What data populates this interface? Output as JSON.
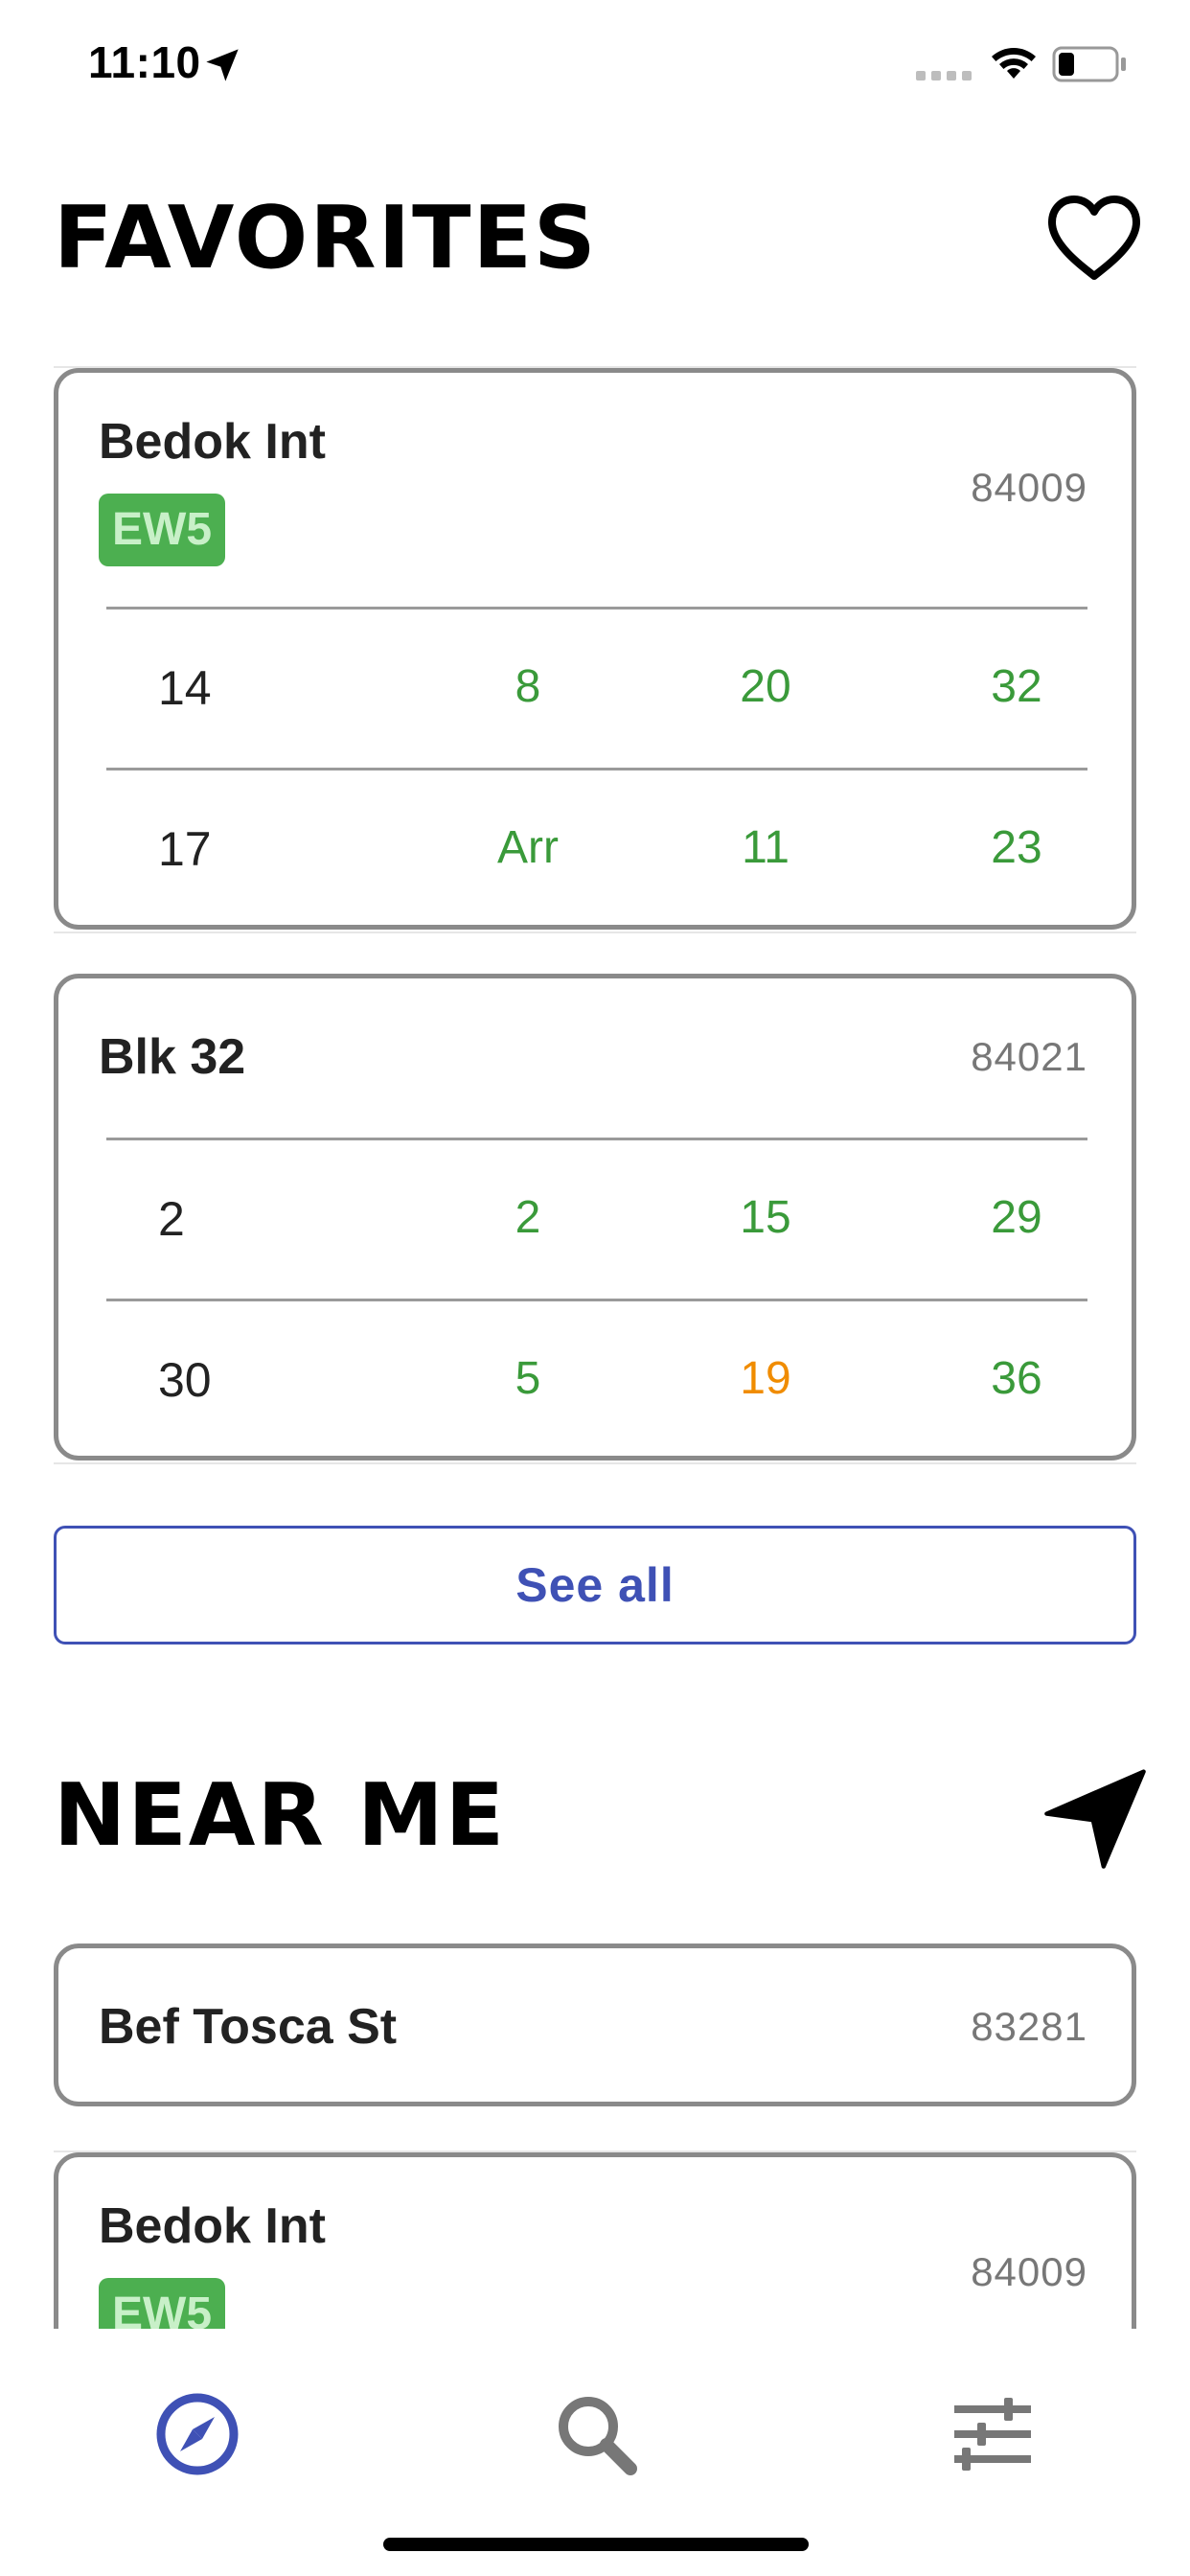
{
  "status_bar": {
    "time": "11:10"
  },
  "favorites": {
    "title": "FAVORITES",
    "stops": [
      {
        "name": "Bedok Int",
        "code": "84009",
        "badge": "EW5",
        "services": [
          {
            "number": "14",
            "etas": [
              "8",
              "20",
              "32"
            ]
          },
          {
            "number": "17",
            "etas": [
              "Arr",
              "11",
              "23"
            ]
          }
        ]
      },
      {
        "name": "Blk 32",
        "code": "84021",
        "services": [
          {
            "number": "2",
            "etas": [
              "2",
              "15",
              "29"
            ]
          },
          {
            "number": "30",
            "etas": [
              "5",
              "19",
              "36"
            ]
          }
        ]
      }
    ],
    "see_all_label": "See all"
  },
  "near_me": {
    "title": "NEAR ME",
    "stops": [
      {
        "name": "Bef Tosca St",
        "code": "83281"
      },
      {
        "name": "Bedok Int",
        "code": "84009",
        "badge": "EW5"
      }
    ]
  },
  "colors": {
    "accent": "#3f51b5",
    "eta_green": "#3a9a3a",
    "eta_orange": "#f08c00",
    "badge_green": "#4caf50"
  },
  "tabs": [
    {
      "icon": "compass-icon",
      "active": true
    },
    {
      "icon": "search-icon",
      "active": false
    },
    {
      "icon": "sliders-icon",
      "active": false
    }
  ]
}
